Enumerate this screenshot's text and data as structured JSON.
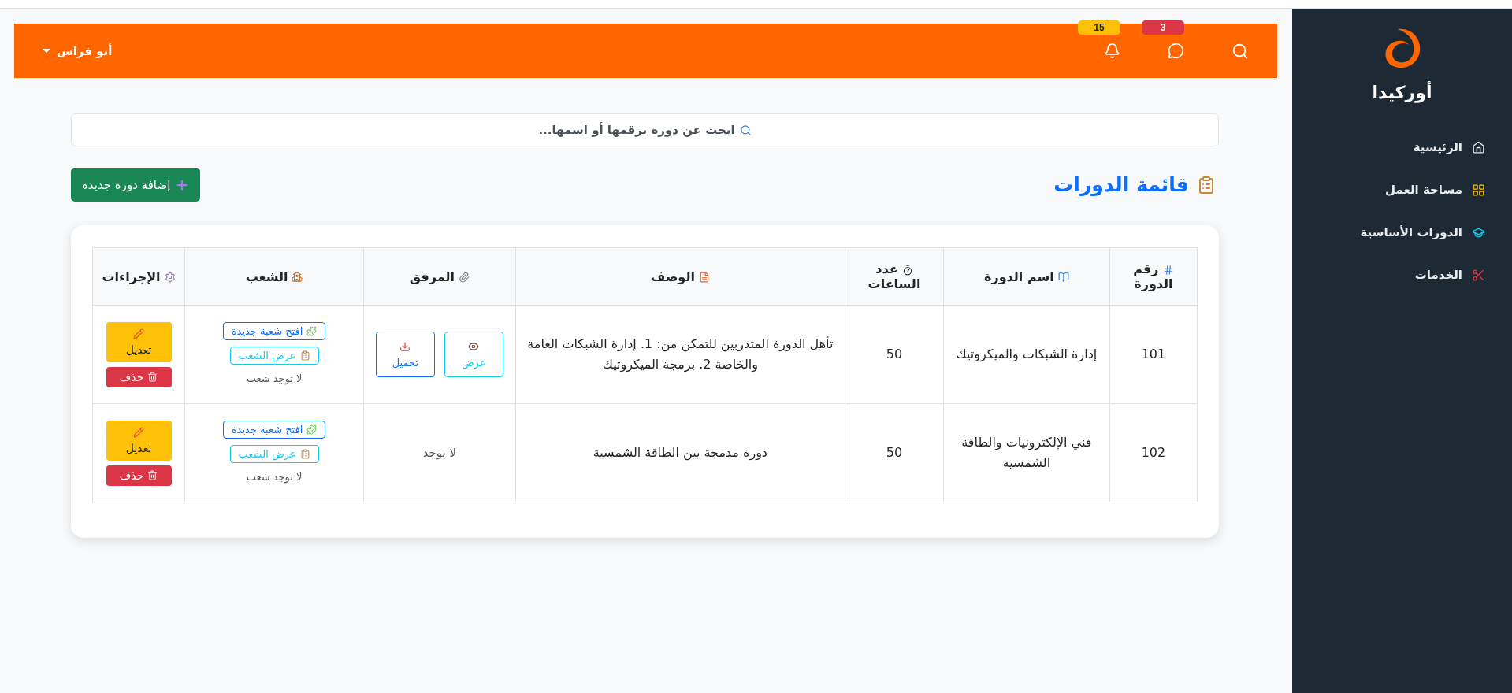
{
  "sidebar": {
    "brand": "أوركيدا",
    "items": [
      {
        "label": "الرئيسية"
      },
      {
        "label": "مساحة العمل"
      },
      {
        "label": "الدورات الأساسية"
      },
      {
        "label": "الخدمات"
      }
    ]
  },
  "header": {
    "messages_badge": "3",
    "notifications_badge": "15",
    "user": "أبو فراس"
  },
  "search": {
    "placeholder": "ابحث عن دورة برقمها أو اسمها..."
  },
  "title": "قائمة الدورات",
  "add_button": "إضافة دورة جديدة",
  "table": {
    "columns": [
      "رقم الدورة",
      "اسم الدورة",
      "عدد الساعات",
      "الوصف",
      "المرفق",
      "الشعب",
      "الإجراءات"
    ],
    "rows": [
      {
        "number": "101",
        "name": "إدارة الشبكات والميكروتيك",
        "hours": "50",
        "description": "تأهل الدورة المتدربين للتمكن من: 1. إدارة الشبكات العامة والخاصة 2. برمجة الميكروتيك",
        "attachment": {
          "kind": "files",
          "view": "عرض",
          "download": "تحميل"
        },
        "branches": {
          "open": "افتح شعبة جديدة",
          "view": "عرض الشعب",
          "note": "لا توجد شعب"
        },
        "actions": {
          "edit": "تعديل",
          "delete": "حذف"
        }
      },
      {
        "number": "102",
        "name": "فني الإلكترونيات والطاقة الشمسية",
        "hours": "50",
        "description": "دورة مدمجة بين الطاقة الشمسية",
        "attachment": {
          "kind": "none",
          "text": "لا يوجد"
        },
        "branches": {
          "open": "افتح شعبة جديدة",
          "view": "عرض الشعب",
          "note": "لا توجد شعب"
        },
        "actions": {
          "edit": "تعديل",
          "delete": "حذف"
        }
      }
    ]
  }
}
